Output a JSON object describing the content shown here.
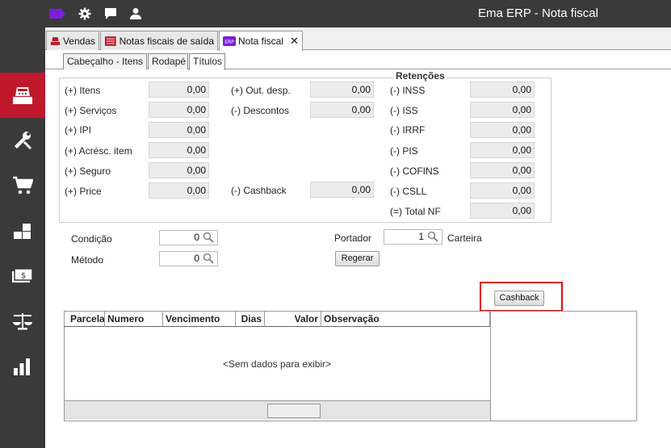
{
  "app": {
    "title": "Ema ERP - Nota fiscal"
  },
  "colors": {
    "topbar": "#3a3a3a",
    "accent": "#c0182b",
    "logo": "#7b1fd6"
  },
  "topbar_icons": [
    "tag-icon",
    "gear-icon",
    "chat-icon",
    "user-icon"
  ],
  "sidebar": {
    "items": [
      {
        "name": "register-icon",
        "active": true
      },
      {
        "name": "tools-icon",
        "active": false
      },
      {
        "name": "cart-icon",
        "active": false
      },
      {
        "name": "boxes-icon",
        "active": false
      },
      {
        "name": "money-icon",
        "active": false
      },
      {
        "name": "scale-icon",
        "active": false
      },
      {
        "name": "bar-chart-icon",
        "active": false
      }
    ]
  },
  "tabs": [
    {
      "label": "Vendas",
      "icon": "register-icon"
    },
    {
      "label": "Notas fiscais de saída",
      "icon": "invoice-icon"
    },
    {
      "label": "Nota fiscal",
      "icon": "erp-icon",
      "active": true
    }
  ],
  "subtabs": [
    {
      "label": "Cabeçalho - Itens"
    },
    {
      "label": "Rodapé"
    },
    {
      "label": "Títulos",
      "active": true
    }
  ],
  "totals": {
    "legend": "Retenções",
    "col1": [
      {
        "label": "(+) Itens",
        "value": "0,00"
      },
      {
        "label": "(+) Serviços",
        "value": "0,00"
      },
      {
        "label": "(+) IPI",
        "value": "0,00"
      },
      {
        "label": "(+) Acrésc. item",
        "value": "0,00"
      },
      {
        "label": "(+) Seguro",
        "value": "0,00"
      },
      {
        "label": "(+) Price",
        "value": "0,00"
      }
    ],
    "col2": [
      {
        "label": "(+) Out. desp.",
        "value": "0,00"
      },
      {
        "label": "(-) Descontos",
        "value": "0,00"
      },
      {
        "label": "(-) Cashback",
        "value": "0,00"
      }
    ],
    "col3": [
      {
        "label": "(-) INSS",
        "value": "0,00"
      },
      {
        "label": "(-) ISS",
        "value": "0,00"
      },
      {
        "label": "(-) IRRF",
        "value": "0,00"
      },
      {
        "label": "(-) PIS",
        "value": "0,00"
      },
      {
        "label": "(-) COFINS",
        "value": "0,00"
      },
      {
        "label": "(-) CSLL",
        "value": "0,00"
      },
      {
        "label": "(=) Total NF",
        "value": "0,00"
      }
    ]
  },
  "form": {
    "condicao_label": "Condição",
    "condicao_value": "0",
    "metodo_label": "Método",
    "metodo_value": "0",
    "portador_label": "Portador",
    "portador_value": "1",
    "carteira_label": "Carteira",
    "regerar_label": "Regerar",
    "cashback_label": "Cashback"
  },
  "grid": {
    "columns": [
      "Parcela",
      "Numero",
      "Vencimento",
      "Dias",
      "Valor",
      "Observação"
    ],
    "empty_text": "<Sem dados para exibir>"
  }
}
